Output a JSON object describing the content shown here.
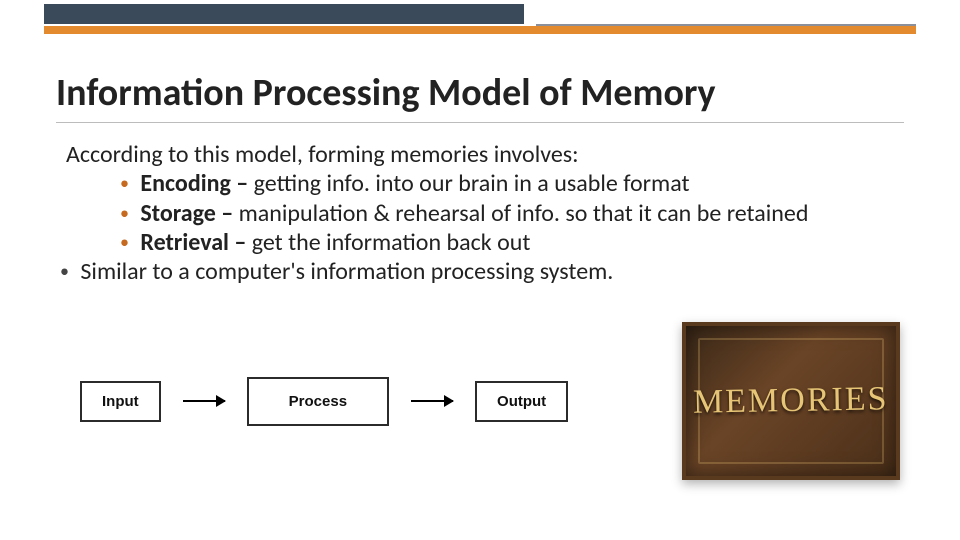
{
  "title": "Information Processing Model of Memory",
  "intro": "According to this model, forming memories involves:",
  "bullets": [
    {
      "term": "Encoding",
      "sep": " – ",
      "desc": "getting info. into our brain in a usable format"
    },
    {
      "term": "Storage",
      "sep": " – ",
      "desc": "manipulation & rehearsal of info. so that it can be retained"
    },
    {
      "term": "Retrieval",
      "sep": " – ",
      "desc": "get the information back out"
    }
  ],
  "outer_bullet": "Similar to a computer's information processing system.",
  "flow": {
    "input": "Input",
    "process": "Process",
    "output": "Output"
  },
  "plaque_text": "MEMORIES"
}
